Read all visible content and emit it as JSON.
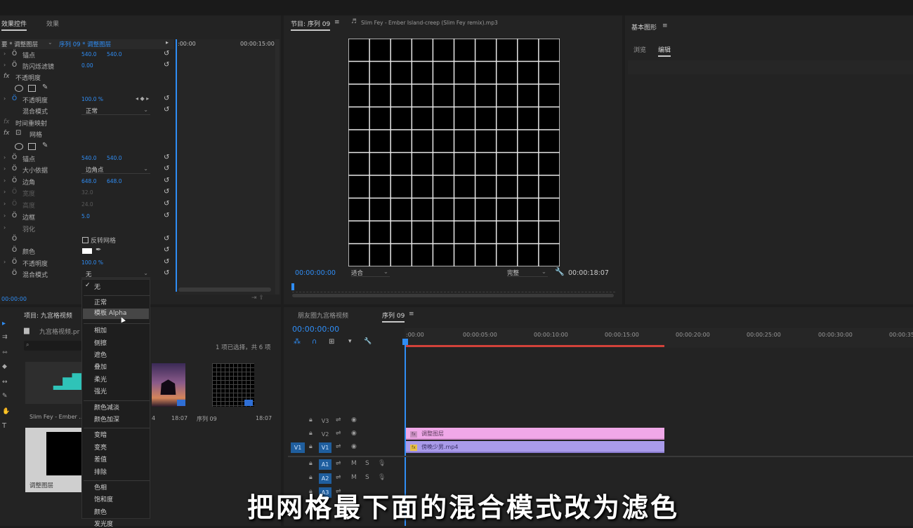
{
  "effect_panel": {
    "tab_effect_controls": "效果控件",
    "tab_effects": "效果",
    "source_clip": "要 * 调整图层",
    "sequence_clip": "序列 09 * 调整图层",
    "time_start": ":00:00",
    "time_end": "00:00:15:00",
    "bottom_time": "00:00:00",
    "rows": {
      "anchor1": {
        "label": "锚点",
        "v1": "540.0",
        "v2": "540.0"
      },
      "flicker": {
        "label": "防闪烁滤镜",
        "v1": "0.00"
      },
      "opacity_section": {
        "label": "不透明度"
      },
      "opacity": {
        "label": "不透明度",
        "v1": "100.0 %"
      },
      "blend1": {
        "label": "混合模式",
        "value": "正常"
      },
      "time_remap": {
        "label": "时间重映射"
      },
      "grid_section": {
        "label": "网格"
      },
      "anchor2": {
        "label": "锚点",
        "v1": "540.0",
        "v2": "540.0"
      },
      "size_from": {
        "label": "大小依据",
        "value": "边角点"
      },
      "corner": {
        "label": "边角",
        "v1": "648.0",
        "v2": "648.0"
      },
      "width": {
        "label": "宽度",
        "v1": "32.0"
      },
      "height": {
        "label": "高度",
        "v1": "24.0"
      },
      "border": {
        "label": "边框",
        "v1": "5.0"
      },
      "feather": {
        "label": "羽化"
      },
      "invert": {
        "label": "反转网格"
      },
      "color": {
        "label": "颜色"
      },
      "opacity2": {
        "label": "不透明度",
        "v1": "100.0 %"
      },
      "blend2": {
        "label": "混合模式",
        "value": "无"
      }
    }
  },
  "blend_dropdown": {
    "items": [
      "无",
      "正常",
      "模板 Alpha",
      "相加",
      "侧擦",
      "遮色",
      "叠加",
      "柔光",
      "强光",
      "颜色减淡",
      "颜色加深",
      "变暗",
      "变亮",
      "差值",
      "排除",
      "色相",
      "饱和度",
      "颜色",
      "发光度"
    ],
    "checked": "无",
    "hovered": "模板 Alpha"
  },
  "program_monitor": {
    "tab_source": "节目: 序列 09",
    "tab_audio": "Slim Fey - Ember Island-creep (Slim Fey remix).mp3",
    "timecode": "00:00:00:00",
    "fit": "适合",
    "quality": "完整",
    "duration": "00:00:18:07"
  },
  "graphics_panel": {
    "title": "基本图形",
    "tab_browse": "浏览",
    "tab_edit": "编辑"
  },
  "project_panel": {
    "title": "项目: 九宫格视频",
    "bin": "九宫格视频.pr",
    "selection_info": "1 项已选择，共 6 项",
    "items": [
      {
        "name": "Slim Fey - Ember ...",
        "duration": ""
      },
      {
        "name": "4",
        "duration": "18:07"
      },
      {
        "name": "序列 09",
        "duration": "18:07"
      },
      {
        "name": "调整图层",
        "duration": ""
      }
    ]
  },
  "timeline": {
    "tab_other": "朋友圈九宫格视频",
    "tab_active": "序列 09",
    "timecode": "00:00:00:00",
    "ticks": [
      ":00:00",
      "00:00:05:00",
      "00:00:10:00",
      "00:00:15:00",
      "00:00:20:00",
      "00:00:25:00",
      "00:00:30:00",
      "00:00:35:"
    ],
    "tracks": {
      "v3": "V3",
      "v2": "V2",
      "v1": "V1",
      "v1_src": "V1",
      "a1": "A1",
      "a2": "A2",
      "a3": "A3",
      "m": "M",
      "s": "S"
    },
    "clips": {
      "v2_clip": "调整图层",
      "v1_clip": "傍晚少男.mp4"
    }
  },
  "subtitle": "把网格最下面的混合模式改为滤色",
  "colors": {
    "accent_blue": "#2f8df5",
    "adjust_layer_clip": "#f0a8e8",
    "video_clip": "#a99bea",
    "work_area": "#d2423a"
  }
}
